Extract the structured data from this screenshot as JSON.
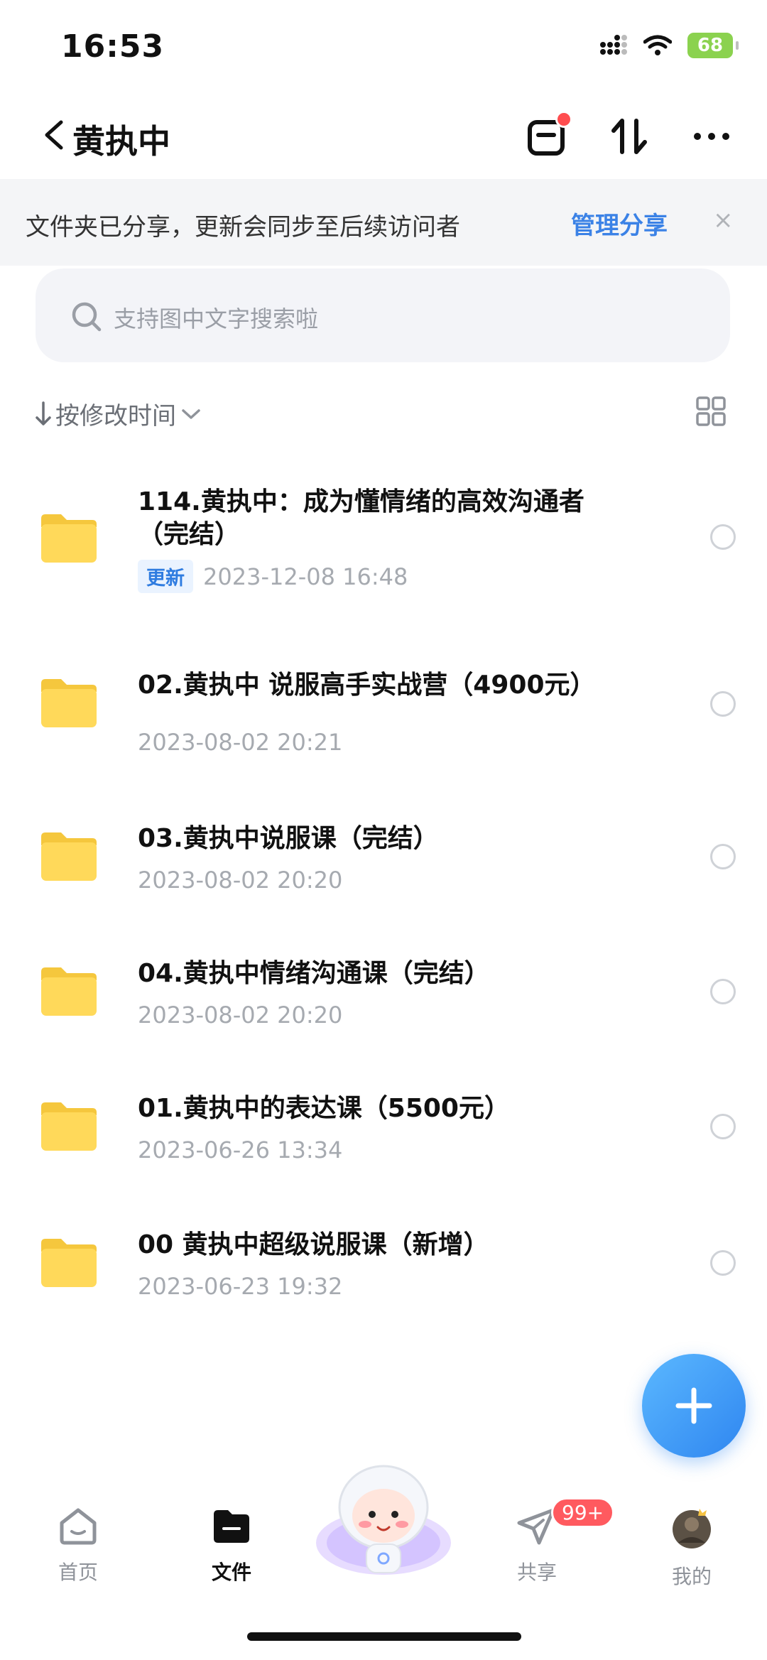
{
  "status_bar": {
    "time": "16:53",
    "battery": "68"
  },
  "header": {
    "title": "黄执中"
  },
  "banner": {
    "text": "文件夹已分享，更新会同步至后续访问者",
    "link": "管理分享",
    "close": "×"
  },
  "search": {
    "placeholder": "支持图中文字搜索啦"
  },
  "sort": {
    "label": "按修改时间"
  },
  "items": [
    {
      "name_line1": "114.黄执中：成为懂情绪的高效沟通者",
      "name_line2": "（完结）",
      "badge": "更新",
      "date": "2023-12-08 16:48"
    },
    {
      "name_line1": "02.黄执中 说服高手实战营（4900元）",
      "date": "2023-08-02 20:21"
    },
    {
      "name_line1": "03.黄执中说服课（完结）",
      "date": "2023-08-02 20:20"
    },
    {
      "name_line1": "04.黄执中情绪沟通课（完结）",
      "date": "2023-08-02 20:20"
    },
    {
      "name_line1": "01.黄执中的表达课（5500元）",
      "date": "2023-06-26 13:34"
    },
    {
      "name_line1": "00 黄执中超级说服课（新增）",
      "date": "2023-06-23 19:32"
    }
  ],
  "nav": {
    "home": "首页",
    "files": "文件",
    "share": "共享",
    "share_badge": "99+",
    "me": "我的"
  }
}
